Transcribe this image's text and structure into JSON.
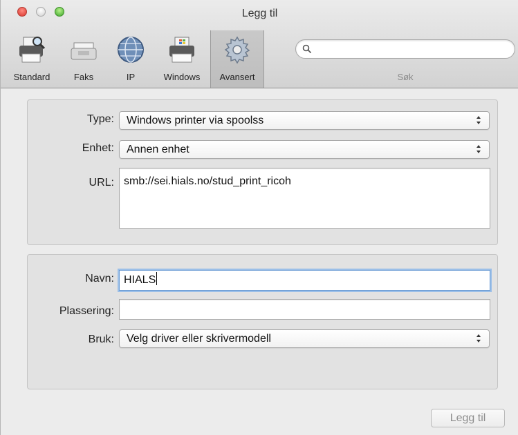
{
  "window": {
    "title": "Legg til"
  },
  "toolbar": {
    "items": [
      {
        "label": "Standard",
        "icon": "printer-magnifier-icon"
      },
      {
        "label": "Faks",
        "icon": "fax-icon"
      },
      {
        "label": "IP",
        "icon": "globe-icon"
      },
      {
        "label": "Windows",
        "icon": "windows-printer-icon"
      },
      {
        "label": "Avansert",
        "icon": "gear-icon",
        "selected": true
      }
    ],
    "search": {
      "value": "",
      "placeholder": "",
      "label": "Søk"
    }
  },
  "connection": {
    "type_label": "Type:",
    "type_value": "Windows printer via spoolss",
    "device_label": "Enhet:",
    "device_value": "Annen enhet",
    "url_label": "URL:",
    "url_value": "smb://sei.hials.no/stud_print_ricoh"
  },
  "details": {
    "name_label": "Navn:",
    "name_value": "HIALS",
    "location_label": "Plassering:",
    "location_value": "",
    "use_label": "Bruk:",
    "use_value": "Velg driver eller skrivermodell"
  },
  "footer": {
    "add_button": "Legg til",
    "add_enabled": false
  },
  "colors": {
    "focus_ring": "#9bbfe8",
    "selected_tool": "#c4c4c4",
    "close": "#d9362e",
    "minimize": "#d0d0d0",
    "zoom": "#3ea42a"
  }
}
